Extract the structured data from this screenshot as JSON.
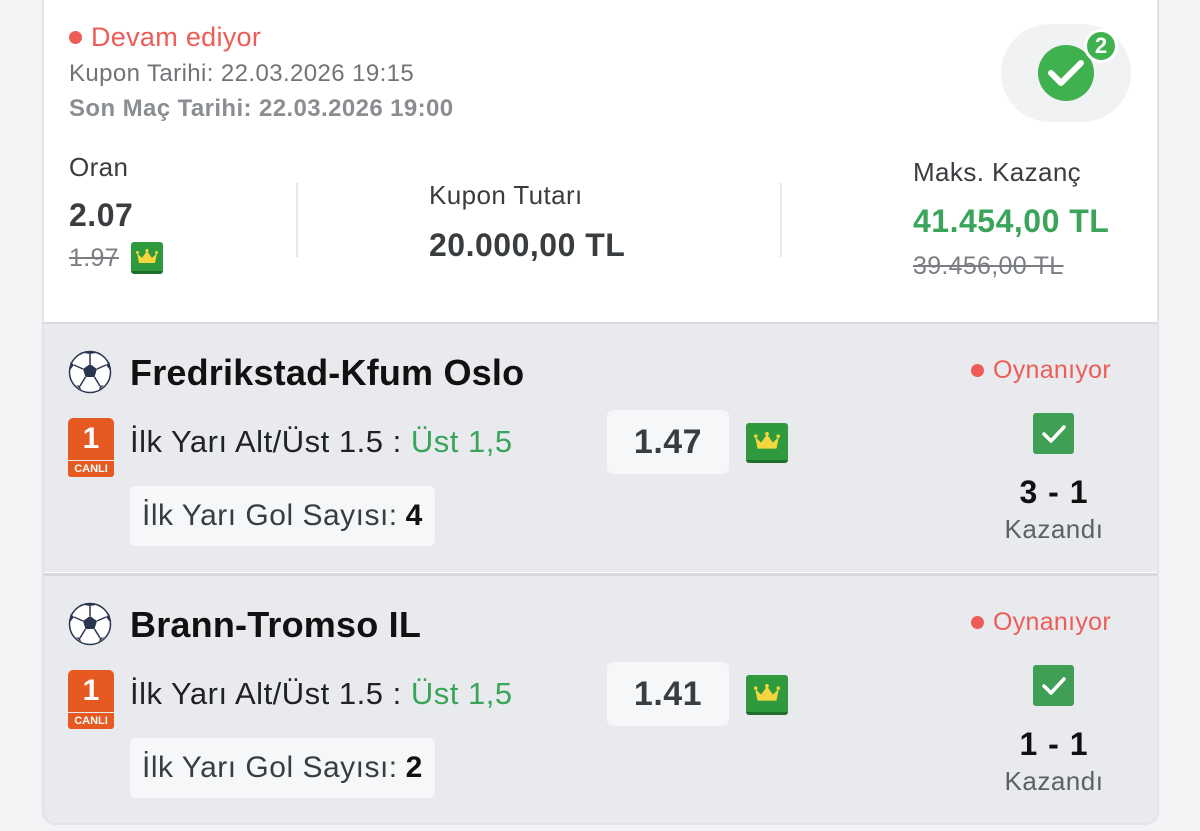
{
  "coupon": {
    "status": "Devam ediyor",
    "coupon_date": "Kupon Tarihi: 22.03.2026 19:15",
    "last_match_date": "Son Maç Tarihi: 22.03.2026 19:00",
    "badge_count": "2"
  },
  "stats": {
    "odds_label": "Oran",
    "odds_value": "2.07",
    "odds_old": "1.97",
    "amount_label": "Kupon Tutarı",
    "amount_value": "20.000,00 TL",
    "max_win_label": "Maks. Kazanç",
    "max_win_value": "41.454,00 TL",
    "max_win_old": "39.456,00 TL"
  },
  "matches": [
    {
      "team": "Fredrikstad-Kfum Oslo",
      "status": "Oynanıyor",
      "live_number": "1",
      "live_label": "CANLI",
      "market": "İlk Yarı Alt/Üst 1.5 :",
      "pick": "Üst 1,5",
      "odd": "1.47",
      "info_label": "İlk Yarı Gol Sayısı:",
      "info_value": "4",
      "score": "3 - 1",
      "result": "Kazandı"
    },
    {
      "team": "Brann-Tromso IL",
      "status": "Oynanıyor",
      "live_number": "1",
      "live_label": "CANLI",
      "market": "İlk Yarı Alt/Üst 1.5 :",
      "pick": "Üst 1,5",
      "odd": "1.41",
      "info_label": "İlk Yarı Gol Sayısı:",
      "info_value": "2",
      "score": "1 - 1",
      "result": "Kazandı"
    }
  ],
  "colors": {
    "status_red": "#ee5c57",
    "win_green": "#3aa55a",
    "crown_green": "#2f9a3d",
    "live_orange": "#e65a22"
  },
  "icons": {
    "status_dot": "status-dot-icon",
    "badge": "checkmark-icon",
    "boost": "crown-icon",
    "sport": "soccer-ball-icon",
    "live": "live-badge-icon",
    "won": "checkbox-checked-icon"
  }
}
